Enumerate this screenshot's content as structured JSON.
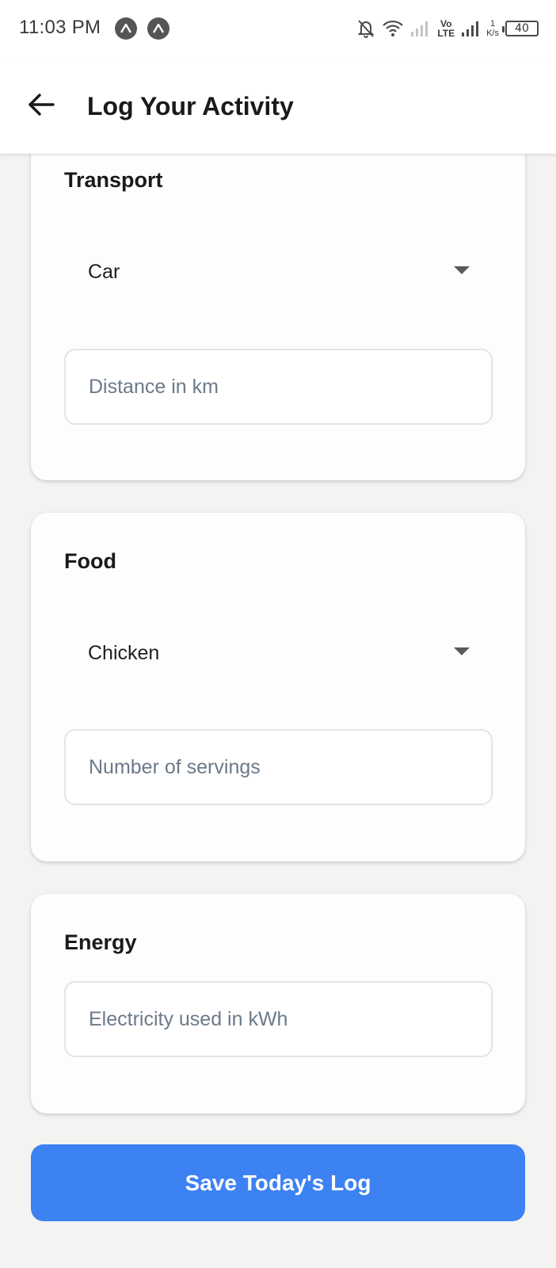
{
  "status_bar": {
    "time": "11:03 PM",
    "icons": [
      "app-notification-icon",
      "app-notification-icon",
      "bell-off-icon",
      "wifi-icon",
      "signal-icon",
      "volte-icon",
      "signal-icon",
      "network-speed-icon",
      "battery-icon"
    ],
    "volte_top": "Vo",
    "volte_bottom": "LTE",
    "speed_value": "1",
    "speed_unit": "K/s",
    "battery_level": "40"
  },
  "header": {
    "back_icon": "arrow-left-icon",
    "title": "Log Your Activity"
  },
  "sections": {
    "transport": {
      "title": "Transport",
      "selected": "Car",
      "placeholder": "Distance in km"
    },
    "food": {
      "title": "Food",
      "selected": "Chicken",
      "placeholder": "Number of servings"
    },
    "energy": {
      "title": "Energy",
      "placeholder": "Electricity used in kWh"
    }
  },
  "save_button": {
    "label": "Save Today's Log"
  },
  "colors": {
    "primary": "#3d82f3",
    "background": "#f3f3f2",
    "card": "#fdfdfd",
    "placeholder_text": "#6b7a8a",
    "input_border": "#e2e4e6"
  }
}
